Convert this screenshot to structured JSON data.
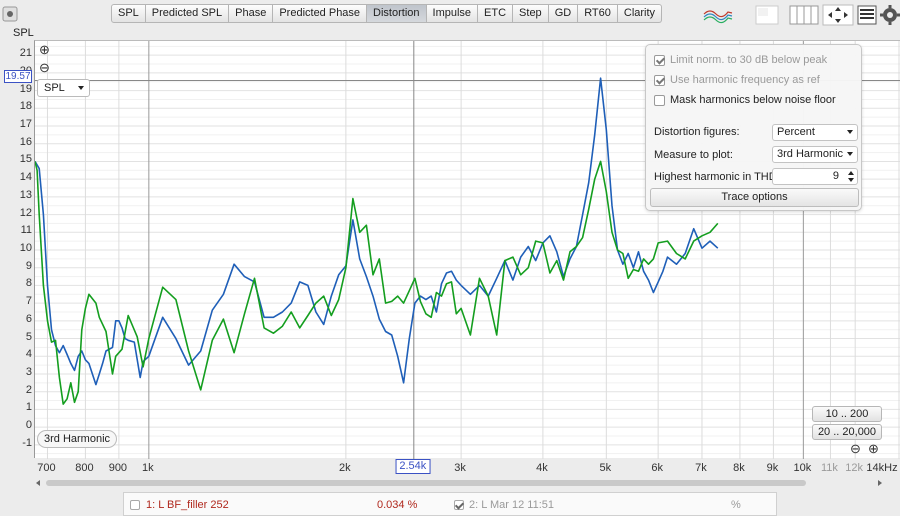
{
  "tabs": [
    "SPL",
    "Predicted SPL",
    "Phase",
    "Predicted Phase",
    "Distortion",
    "Impulse",
    "ETC",
    "Step",
    "GD",
    "RT60",
    "Clarity"
  ],
  "active_tab": "Distortion",
  "y_unit": "SPL",
  "y_ticks": [
    "21",
    "20",
    "19",
    "18",
    "17",
    "16",
    "15",
    "14",
    "13",
    "12",
    "11",
    "10",
    "9",
    "8",
    "7",
    "6",
    "5",
    "4",
    "3",
    "2",
    "1",
    "0",
    "-1"
  ],
  "cursor_y_value": "19.57",
  "cursor_x_value": "2.54k",
  "plot_select": "SPL",
  "trace_label": "3rd Harmonic",
  "panel": {
    "limit_norm": "Limit norm. to 30 dB below peak",
    "use_harmonic": "Use harmonic frequency as ref",
    "mask_harmonics": "Mask harmonics below noise floor",
    "distortion_figures_label": "Distortion figures:",
    "distortion_figures_value": "Percent",
    "measure_label": "Measure to plot:",
    "measure_value": "3rd Harmonic",
    "highest_label": "Highest harmonic in THD:",
    "highest_value": "9",
    "trace_options": "Trace options"
  },
  "range_buttons": {
    "r1": "10 .. 200",
    "r2": "20 .. 20,000"
  },
  "x_ticks": [
    {
      "label": "700",
      "f": 700,
      "light": false
    },
    {
      "label": "800",
      "f": 800,
      "light": false
    },
    {
      "label": "900",
      "f": 900,
      "light": false
    },
    {
      "label": "1k",
      "f": 1000,
      "light": false
    },
    {
      "label": "2k",
      "f": 2000,
      "light": false
    },
    {
      "label": "3k",
      "f": 3000,
      "light": false
    },
    {
      "label": "4k",
      "f": 4000,
      "light": false
    },
    {
      "label": "5k",
      "f": 5000,
      "light": false
    },
    {
      "label": "6k",
      "f": 6000,
      "light": false
    },
    {
      "label": "7k",
      "f": 7000,
      "light": false
    },
    {
      "label": "8k",
      "f": 8000,
      "light": false
    },
    {
      "label": "9k",
      "f": 9000,
      "light": false
    },
    {
      "label": "10k",
      "f": 10000,
      "light": false
    },
    {
      "label": "11k",
      "f": 11000,
      "light": true
    },
    {
      "label": "12k",
      "f": 12000,
      "light": true
    },
    {
      "label": "14kHz",
      "f": 14000,
      "light": false
    }
  ],
  "legend": {
    "m1_name": "1: L BF_filler 252",
    "m1_value": "0.034 %",
    "m2_name": "2: L Mar 12 11:51",
    "m2_value": "%"
  },
  "colors": {
    "blue": "#1f5fb8",
    "green": "#149e1f",
    "m1_text": "#b0281d"
  },
  "chart_data": {
    "type": "line",
    "xlabel": "",
    "ylabel": "SPL",
    "xscale": "log",
    "xlim": [
      670,
      14000
    ],
    "ylim": [
      -1.8,
      21.8
    ],
    "grid": true,
    "series": [
      {
        "name": "",
        "color": "blue",
        "points": [
          [
            670,
            15
          ],
          [
            680,
            14.6
          ],
          [
            690,
            12
          ],
          [
            700,
            8
          ],
          [
            710,
            5.5
          ],
          [
            720,
            4.6
          ],
          [
            730,
            4.2
          ],
          [
            740,
            4.6
          ],
          [
            750,
            4.1
          ],
          [
            760,
            3.6
          ],
          [
            770,
            3.2
          ],
          [
            780,
            4.0
          ],
          [
            790,
            4.3
          ],
          [
            800,
            3.8
          ],
          [
            810,
            3.6
          ],
          [
            830,
            2.4
          ],
          [
            840,
            3.0
          ],
          [
            850,
            3.6
          ],
          [
            860,
            4.3
          ],
          [
            880,
            4.5
          ],
          [
            890,
            6.0
          ],
          [
            900,
            6.0
          ],
          [
            910,
            5.6
          ],
          [
            920,
            5.0
          ],
          [
            930,
            4.9
          ],
          [
            950,
            4.8
          ],
          [
            970,
            2.8
          ],
          [
            980,
            3.7
          ],
          [
            1000,
            4.0
          ],
          [
            1050,
            6.2
          ],
          [
            1100,
            5.0
          ],
          [
            1150,
            3.5
          ],
          [
            1200,
            4.3
          ],
          [
            1250,
            6.6
          ],
          [
            1300,
            7.5
          ],
          [
            1350,
            9.2
          ],
          [
            1400,
            8.5
          ],
          [
            1450,
            8.2
          ],
          [
            1500,
            6.2
          ],
          [
            1550,
            6.2
          ],
          [
            1600,
            6.5
          ],
          [
            1650,
            7.0
          ],
          [
            1700,
            8.2
          ],
          [
            1750,
            8.0
          ],
          [
            1800,
            6.5
          ],
          [
            1850,
            5.8
          ],
          [
            1900,
            7.4
          ],
          [
            1950,
            8.6
          ],
          [
            2000,
            9.1
          ],
          [
            2050,
            11.7
          ],
          [
            2100,
            9.5
          ],
          [
            2150,
            8.5
          ],
          [
            2200,
            7.4
          ],
          [
            2250,
            6.1
          ],
          [
            2300,
            5.4
          ],
          [
            2350,
            5.2
          ],
          [
            2400,
            4.0
          ],
          [
            2450,
            2.5
          ],
          [
            2500,
            5.0
          ],
          [
            2550,
            7.0
          ],
          [
            2600,
            7.4
          ],
          [
            2650,
            7.2
          ],
          [
            2700,
            7.4
          ],
          [
            2750,
            6.5
          ],
          [
            2800,
            8.1
          ],
          [
            2850,
            8.7
          ],
          [
            2900,
            8.8
          ],
          [
            2950,
            8.3
          ],
          [
            3000,
            8.0
          ],
          [
            3100,
            7.5
          ],
          [
            3200,
            8.0
          ],
          [
            3300,
            7.4
          ],
          [
            3400,
            8.4
          ],
          [
            3500,
            9.4
          ],
          [
            3600,
            8.3
          ],
          [
            3700,
            9.6
          ],
          [
            3800,
            10.2
          ],
          [
            3900,
            9.4
          ],
          [
            4000,
            10.4
          ],
          [
            4100,
            10.8
          ],
          [
            4200,
            9.9
          ],
          [
            4300,
            8.5
          ],
          [
            4400,
            9.5
          ],
          [
            4500,
            10.2
          ],
          [
            4600,
            12.0
          ],
          [
            4700,
            13.8
          ],
          [
            4800,
            16.5
          ],
          [
            4900,
            19.7
          ],
          [
            5000,
            16.8
          ],
          [
            5100,
            12.5
          ],
          [
            5200,
            10.0
          ],
          [
            5300,
            9.2
          ],
          [
            5400,
            9.8
          ],
          [
            5500,
            9.0
          ],
          [
            5600,
            9.9
          ],
          [
            5700,
            8.8
          ],
          [
            5800,
            8.3
          ],
          [
            5900,
            7.6
          ],
          [
            6000,
            8.2
          ],
          [
            6100,
            8.8
          ],
          [
            6200,
            9.6
          ],
          [
            6400,
            9.2
          ],
          [
            6600,
            9.8
          ],
          [
            6800,
            11.2
          ],
          [
            7000,
            10.1
          ],
          [
            7200,
            10.5
          ],
          [
            7400,
            10.1
          ]
        ]
      },
      {
        "name": "",
        "color": "green",
        "points": [
          [
            670,
            15
          ],
          [
            675,
            14.5
          ],
          [
            680,
            12
          ],
          [
            690,
            8
          ],
          [
            700,
            6.0
          ],
          [
            710,
            4.8
          ],
          [
            720,
            4.9
          ],
          [
            730,
            2.8
          ],
          [
            740,
            1.3
          ],
          [
            750,
            1.6
          ],
          [
            760,
            2.5
          ],
          [
            770,
            1.4
          ],
          [
            780,
            2.0
          ],
          [
            790,
            5.5
          ],
          [
            800,
            6.7
          ],
          [
            810,
            7.5
          ],
          [
            830,
            7.0
          ],
          [
            840,
            6.2
          ],
          [
            860,
            5.4
          ],
          [
            880,
            3.0
          ],
          [
            890,
            4.0
          ],
          [
            910,
            4.4
          ],
          [
            930,
            6.3
          ],
          [
            960,
            5.1
          ],
          [
            980,
            3.4
          ],
          [
            1000,
            5.0
          ],
          [
            1050,
            7.9
          ],
          [
            1100,
            7.2
          ],
          [
            1150,
            4.3
          ],
          [
            1200,
            2.1
          ],
          [
            1250,
            4.9
          ],
          [
            1300,
            6.1
          ],
          [
            1350,
            4.2
          ],
          [
            1400,
            6.4
          ],
          [
            1450,
            8.4
          ],
          [
            1500,
            5.6
          ],
          [
            1550,
            5.3
          ],
          [
            1600,
            5.7
          ],
          [
            1650,
            6.5
          ],
          [
            1700,
            5.6
          ],
          [
            1750,
            6.3
          ],
          [
            1800,
            7.0
          ],
          [
            1850,
            7.4
          ],
          [
            1900,
            6.3
          ],
          [
            1950,
            7.2
          ],
          [
            2000,
            9.0
          ],
          [
            2050,
            12.9
          ],
          [
            2100,
            11.0
          ],
          [
            2150,
            11.4
          ],
          [
            2200,
            8.6
          ],
          [
            2250,
            9.5
          ],
          [
            2300,
            7.0
          ],
          [
            2350,
            7.1
          ],
          [
            2400,
            7.4
          ],
          [
            2450,
            7.0
          ],
          [
            2500,
            7.7
          ],
          [
            2550,
            8.4
          ],
          [
            2600,
            7.1
          ],
          [
            2650,
            6.4
          ],
          [
            2700,
            6.2
          ],
          [
            2750,
            7.6
          ],
          [
            2800,
            7.4
          ],
          [
            2850,
            8.1
          ],
          [
            2900,
            8.2
          ],
          [
            2950,
            6.4
          ],
          [
            3000,
            6.7
          ],
          [
            3100,
            5.2
          ],
          [
            3200,
            8.4
          ],
          [
            3300,
            7.4
          ],
          [
            3400,
            5.2
          ],
          [
            3500,
            9.4
          ],
          [
            3600,
            9.6
          ],
          [
            3700,
            8.6
          ],
          [
            3800,
            9.0
          ],
          [
            3900,
            10.5
          ],
          [
            4000,
            10.4
          ],
          [
            4100,
            8.7
          ],
          [
            4200,
            9.4
          ],
          [
            4300,
            8.3
          ],
          [
            4400,
            9.9
          ],
          [
            4500,
            10.2
          ],
          [
            4600,
            10.7
          ],
          [
            4700,
            12.3
          ],
          [
            4800,
            14.0
          ],
          [
            4900,
            15.0
          ],
          [
            5000,
            13.3
          ],
          [
            5100,
            11.0
          ],
          [
            5200,
            10.0
          ],
          [
            5300,
            9.8
          ],
          [
            5400,
            8.4
          ],
          [
            5500,
            8.9
          ],
          [
            5600,
            8.8
          ],
          [
            5700,
            9.5
          ],
          [
            5800,
            9.2
          ],
          [
            5900,
            9.5
          ],
          [
            6000,
            10.4
          ],
          [
            6200,
            10.5
          ],
          [
            6400,
            9.8
          ],
          [
            6600,
            9.5
          ],
          [
            6800,
            10.5
          ],
          [
            7000,
            10.8
          ],
          [
            7200,
            11.0
          ],
          [
            7400,
            11.5
          ]
        ]
      }
    ]
  }
}
